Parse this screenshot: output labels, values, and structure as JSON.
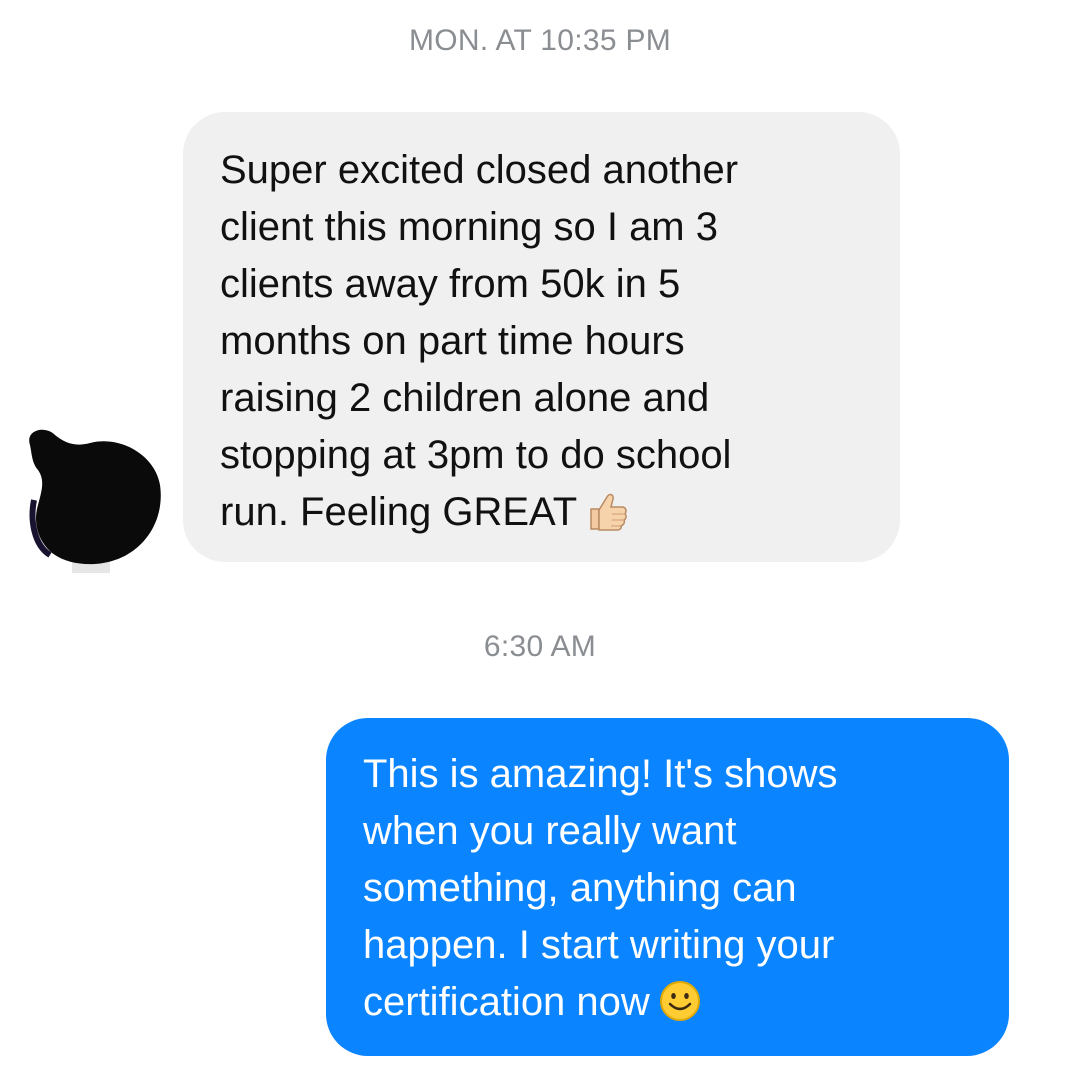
{
  "conversation": {
    "timestamp_1": "MON. AT 10:35 PM",
    "timestamp_2": "6:30 AM",
    "messages": [
      {
        "direction": "incoming",
        "text": "Super excited closed another\nclient this morning so I am 3\nclients away from 50k in 5\nmonths on part time hours\nraising 2 children alone and\nstopping at 3pm to do school\nrun.  Feeling GREAT",
        "emoji": "thumbs-up-icon"
      },
      {
        "direction": "outgoing",
        "text": "This is amazing! It's shows\nwhen you really want\nsomething, anything can\nhappen. I start writing your\ncertification now",
        "emoji": "smiling-face-icon"
      }
    ]
  },
  "colors": {
    "incoming_bubble": "#f0f0f0",
    "outgoing_bubble": "#0a84ff",
    "timestamp_text": "#8a8d91"
  }
}
